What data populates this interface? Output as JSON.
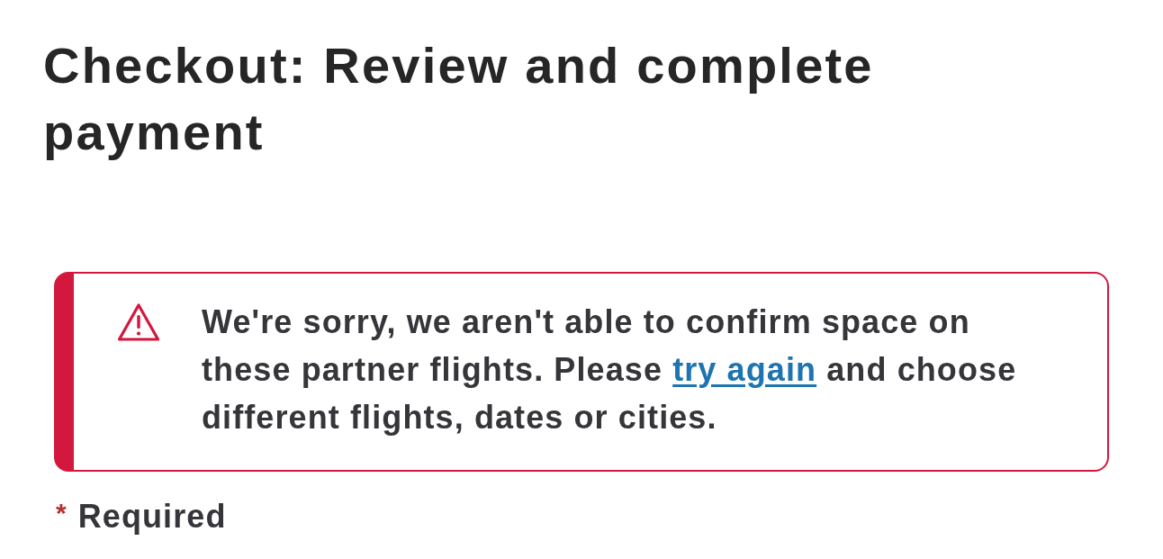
{
  "page": {
    "title": "Checkout: Review and complete payment"
  },
  "alert": {
    "kind": "error",
    "parts": [
      {
        "kind": "text",
        "text": "We're sorry, we aren't able to confirm space on these partner flights. Please "
      },
      {
        "kind": "link",
        "text": "try again"
      },
      {
        "kind": "text",
        "text": " and choose different flights, dates or cities."
      }
    ]
  },
  "required_note": {
    "marker": "*",
    "label": "Required"
  }
}
